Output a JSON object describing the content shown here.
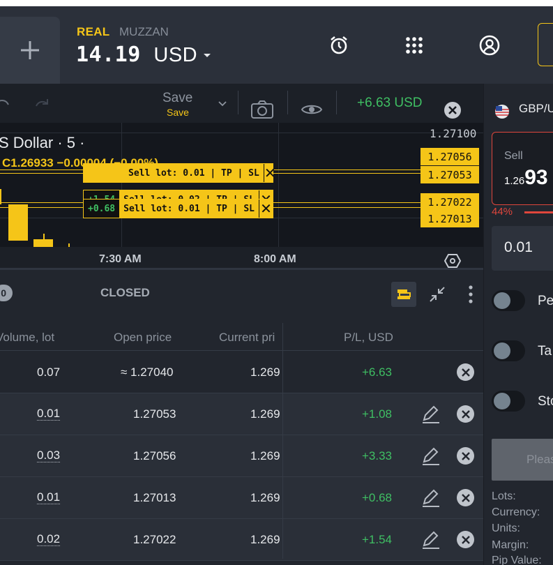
{
  "header": {
    "new_tab_icon": "plus-icon",
    "account_type": "REAL",
    "account_name": "MUZZAN",
    "balance_value": "14.19",
    "balance_currency": "USD",
    "icons": [
      "alarm-clock-icon",
      "apps-grid-icon",
      "user-profile-icon"
    ],
    "accent": "#f5c518"
  },
  "toolbar": {
    "save_label": "Save",
    "save_sub": "Save",
    "floating_pl": "+6.63 USD",
    "icons": [
      "undo-icon",
      "redo-icon",
      "chevron-down-icon",
      "camera-icon",
      "eye-icon",
      "close-circle-icon"
    ]
  },
  "chart": {
    "symbol_title": "S Dollar · 5 ·",
    "ohlc_text": "C1.26933 −0.00004 (−0.00%)",
    "axis_top_price": "1.27100",
    "orders": [
      {
        "pl": "",
        "label": "Sell lot: 0.01 | TP | SL",
        "close": "✕"
      },
      {
        "pl": "+1.54",
        "label": "Sell lot: 0.02 | TP | SL",
        "close": "✕"
      },
      {
        "pl": "+0.68",
        "label": "Sell lot: 0.01 | TP | SL",
        "close": "✕"
      }
    ],
    "price_tags": [
      "1.27056",
      "1.27053",
      "1.27022",
      "1.27013"
    ],
    "x_labels": [
      "7:30 AM",
      "8:00 AM"
    ],
    "settings_icon": "hexagon-settings-icon",
    "candle_color": "#f5c518",
    "profit_color": "#3fbf63"
  },
  "panel": {
    "open_count": "0",
    "closed_tab": "CLOSED",
    "icons": [
      "stack-layers-icon",
      "collapse-arrows-icon",
      "more-vertical-icon"
    ],
    "columns": [
      "Volume, lot",
      "Open price",
      "Current pri",
      "P/L, USD"
    ],
    "rows": [
      {
        "volume": "0.07",
        "open": "≈ 1.27040",
        "current": "1.269",
        "pl": "+6.63",
        "editable": false
      },
      {
        "volume": "0.01",
        "open": "1.27053",
        "current": "1.269",
        "pl": "+1.08",
        "editable": true
      },
      {
        "volume": "0.03",
        "open": "1.27056",
        "current": "1.269",
        "pl": "+3.33",
        "editable": true
      },
      {
        "volume": "0.01",
        "open": "1.27013",
        "current": "1.269",
        "pl": "+0.68",
        "editable": true
      },
      {
        "volume": "0.02",
        "open": "1.27022",
        "current": "1.269",
        "pl": "+1.54",
        "editable": true
      }
    ]
  },
  "order_panel": {
    "symbol": "GBP/U",
    "flag_icon": "us-flag-icon",
    "sell_label": "Sell",
    "sell_price_small": "1.26",
    "sell_price_big": "93",
    "sentiment_pct": "44%",
    "lot_value": "0.01",
    "toggles": [
      "Pe",
      "Ta",
      "Sto"
    ],
    "place_label": "Pleas",
    "info_labels": [
      "Lots:",
      "Currency:",
      "Units:",
      "Margin:",
      "Pip Value:"
    ],
    "sell_color": "#e0463c"
  }
}
